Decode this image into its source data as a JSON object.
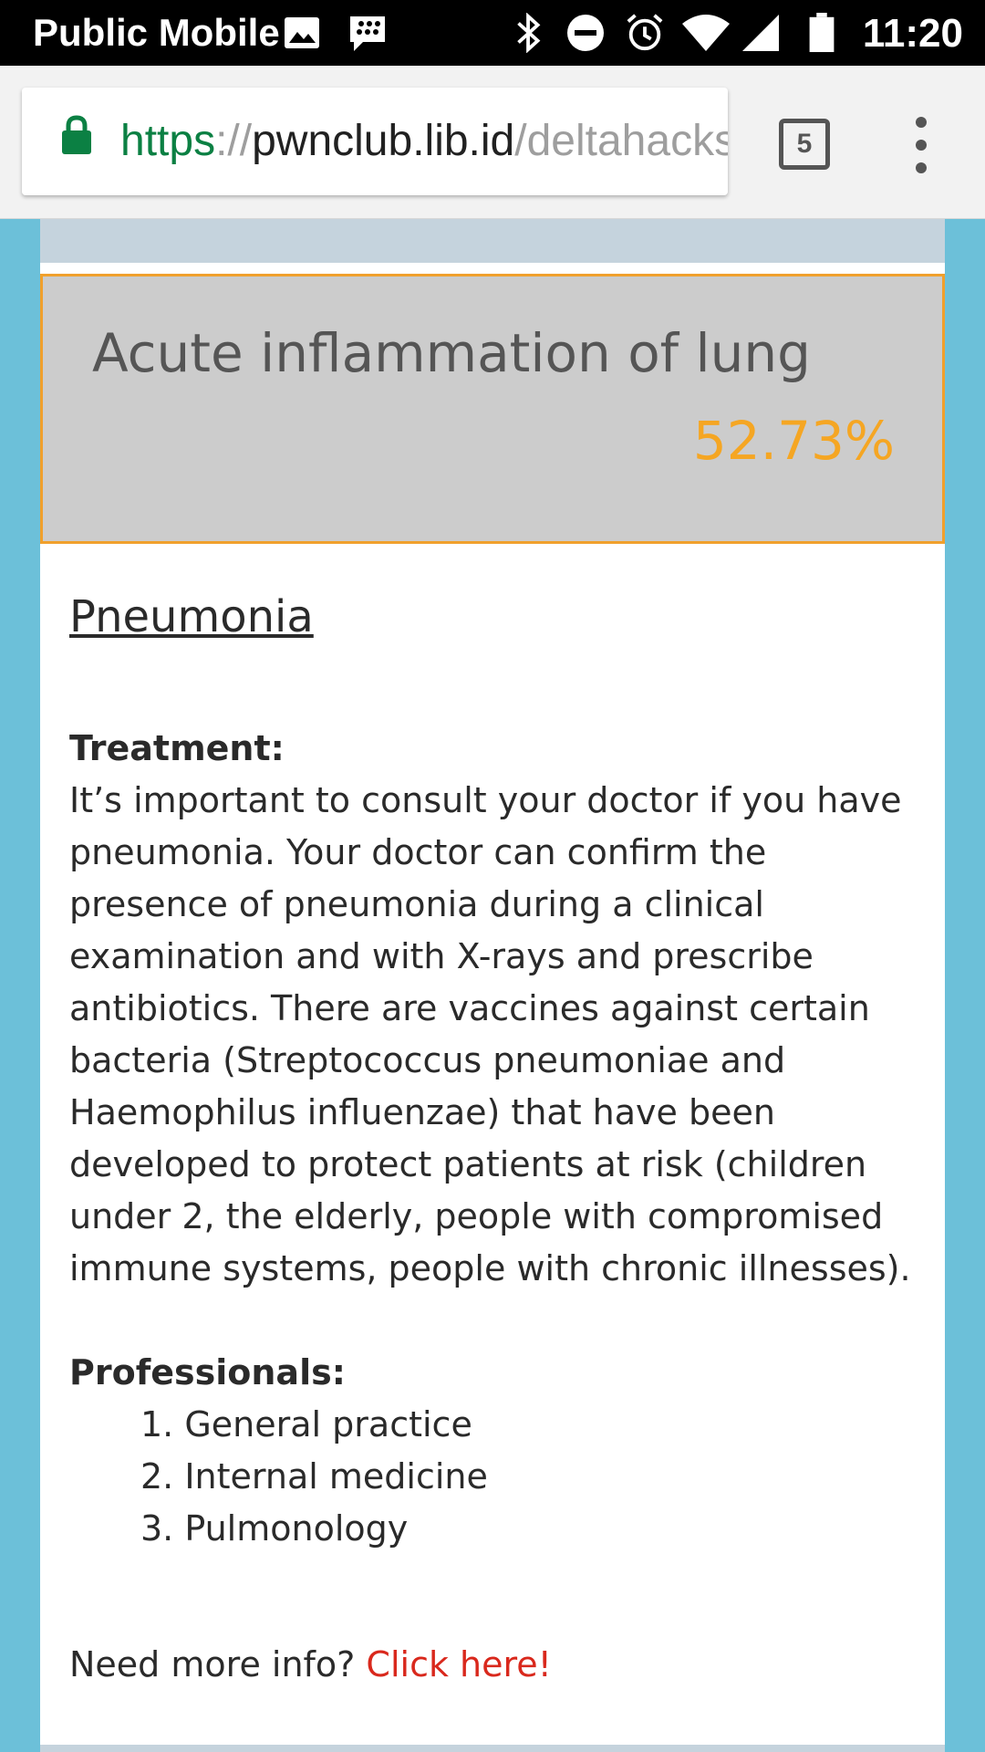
{
  "status_bar": {
    "carrier": "Public Mobile",
    "time": "11:20",
    "icons": [
      "image-icon",
      "bbm-icon",
      "bluetooth-icon",
      "do-not-disturb-icon",
      "alarm-icon",
      "wifi-icon",
      "signal-icon",
      "battery-icon"
    ]
  },
  "browser": {
    "url_scheme": "https",
    "url_sep": "://",
    "url_host": "pwnclub.lib.id",
    "url_path": "/deltahacks",
    "tab_count": "5",
    "colors": {
      "secure": "#0b8043"
    }
  },
  "result": {
    "title": "Acute inflammation of lung",
    "percent": "52.73%",
    "colors": {
      "accent": "#f5a623",
      "border": "#f0a02c",
      "box_bg": "#cccccc"
    }
  },
  "content": {
    "disease_name": "Pneumonia",
    "treatment_heading": "Treatment:",
    "treatment_text": "It’s important to consult your doctor if you have pneumonia. Your doctor can confirm the presence of pneumonia during a clinical examination and with X-rays and prescribe antibiotics. There are vaccines against certain bacteria (Streptococcus pneumoniae and Haemophilus influenzae) that have been developed to protect patients at risk (children under 2, the elderly, people with compromised immune systems, people with chronic illnesses).",
    "professionals_heading": "Professionals:",
    "professionals": [
      "1. General practice",
      "2. Internal medicine",
      "3. Pulmonology"
    ],
    "more_info_prefix": "Need more info? ",
    "more_info_link": "Click here!",
    "colors": {
      "link": "#d9281c",
      "page_bg": "#6cc0d9"
    }
  }
}
